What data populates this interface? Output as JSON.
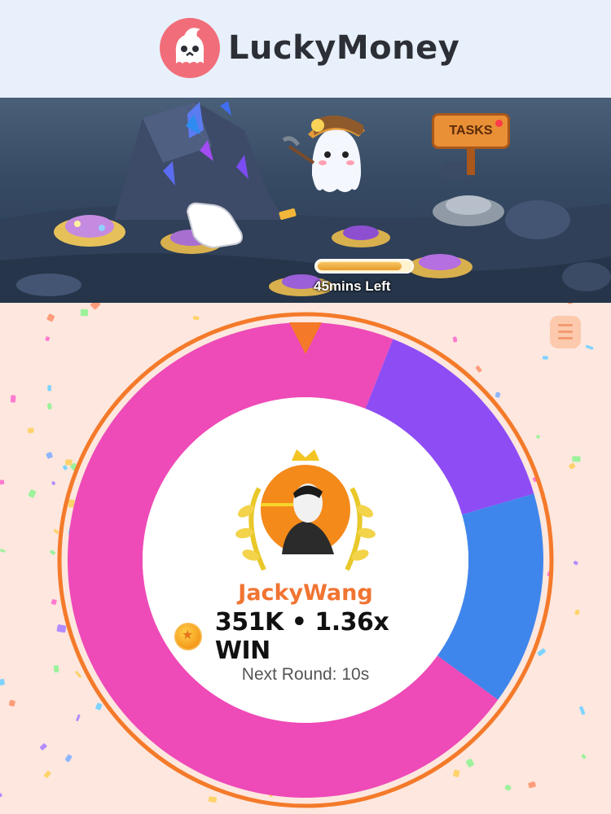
{
  "app": {
    "name": "LuckyMoney",
    "logo_icon": "ghost-skull-icon"
  },
  "banner": {
    "tasks_label": "TASKS",
    "tasks_notification": true,
    "progress_fraction": 0.9,
    "time_left": "45mins Left",
    "icons": [
      "crystal-rock-icon",
      "ghost-miner-icon",
      "tap-hand-icon",
      "treasure-pile-icon",
      "stone-pile-icon",
      "gold-bar-icon"
    ]
  },
  "wheel": {
    "pointer_icon": "pointer-triangle-icon",
    "segments": [
      {
        "name": "pink",
        "color": "#ee4ab8",
        "fraction": 0.06
      },
      {
        "name": "purple",
        "color": "#8e4cf5",
        "fraction": 0.145
      },
      {
        "name": "blue",
        "color": "#3f86ec",
        "fraction": 0.145
      },
      {
        "name": "pink-large",
        "color": "#ee4ab8",
        "fraction": 0.65
      }
    ],
    "ring_color": "#f47a2a"
  },
  "winner": {
    "avatar_icon": "winner-avatar-icon",
    "crown_icon": "crown-icon",
    "laurel_icon": "laurel-wreath-icon",
    "username": "JackyWang",
    "coin_icon": "coin-star-icon",
    "win_text": "351K • 1.36x WIN",
    "next_round": "Next Round: 10s"
  },
  "menu_icon": "menu-list-icon"
}
